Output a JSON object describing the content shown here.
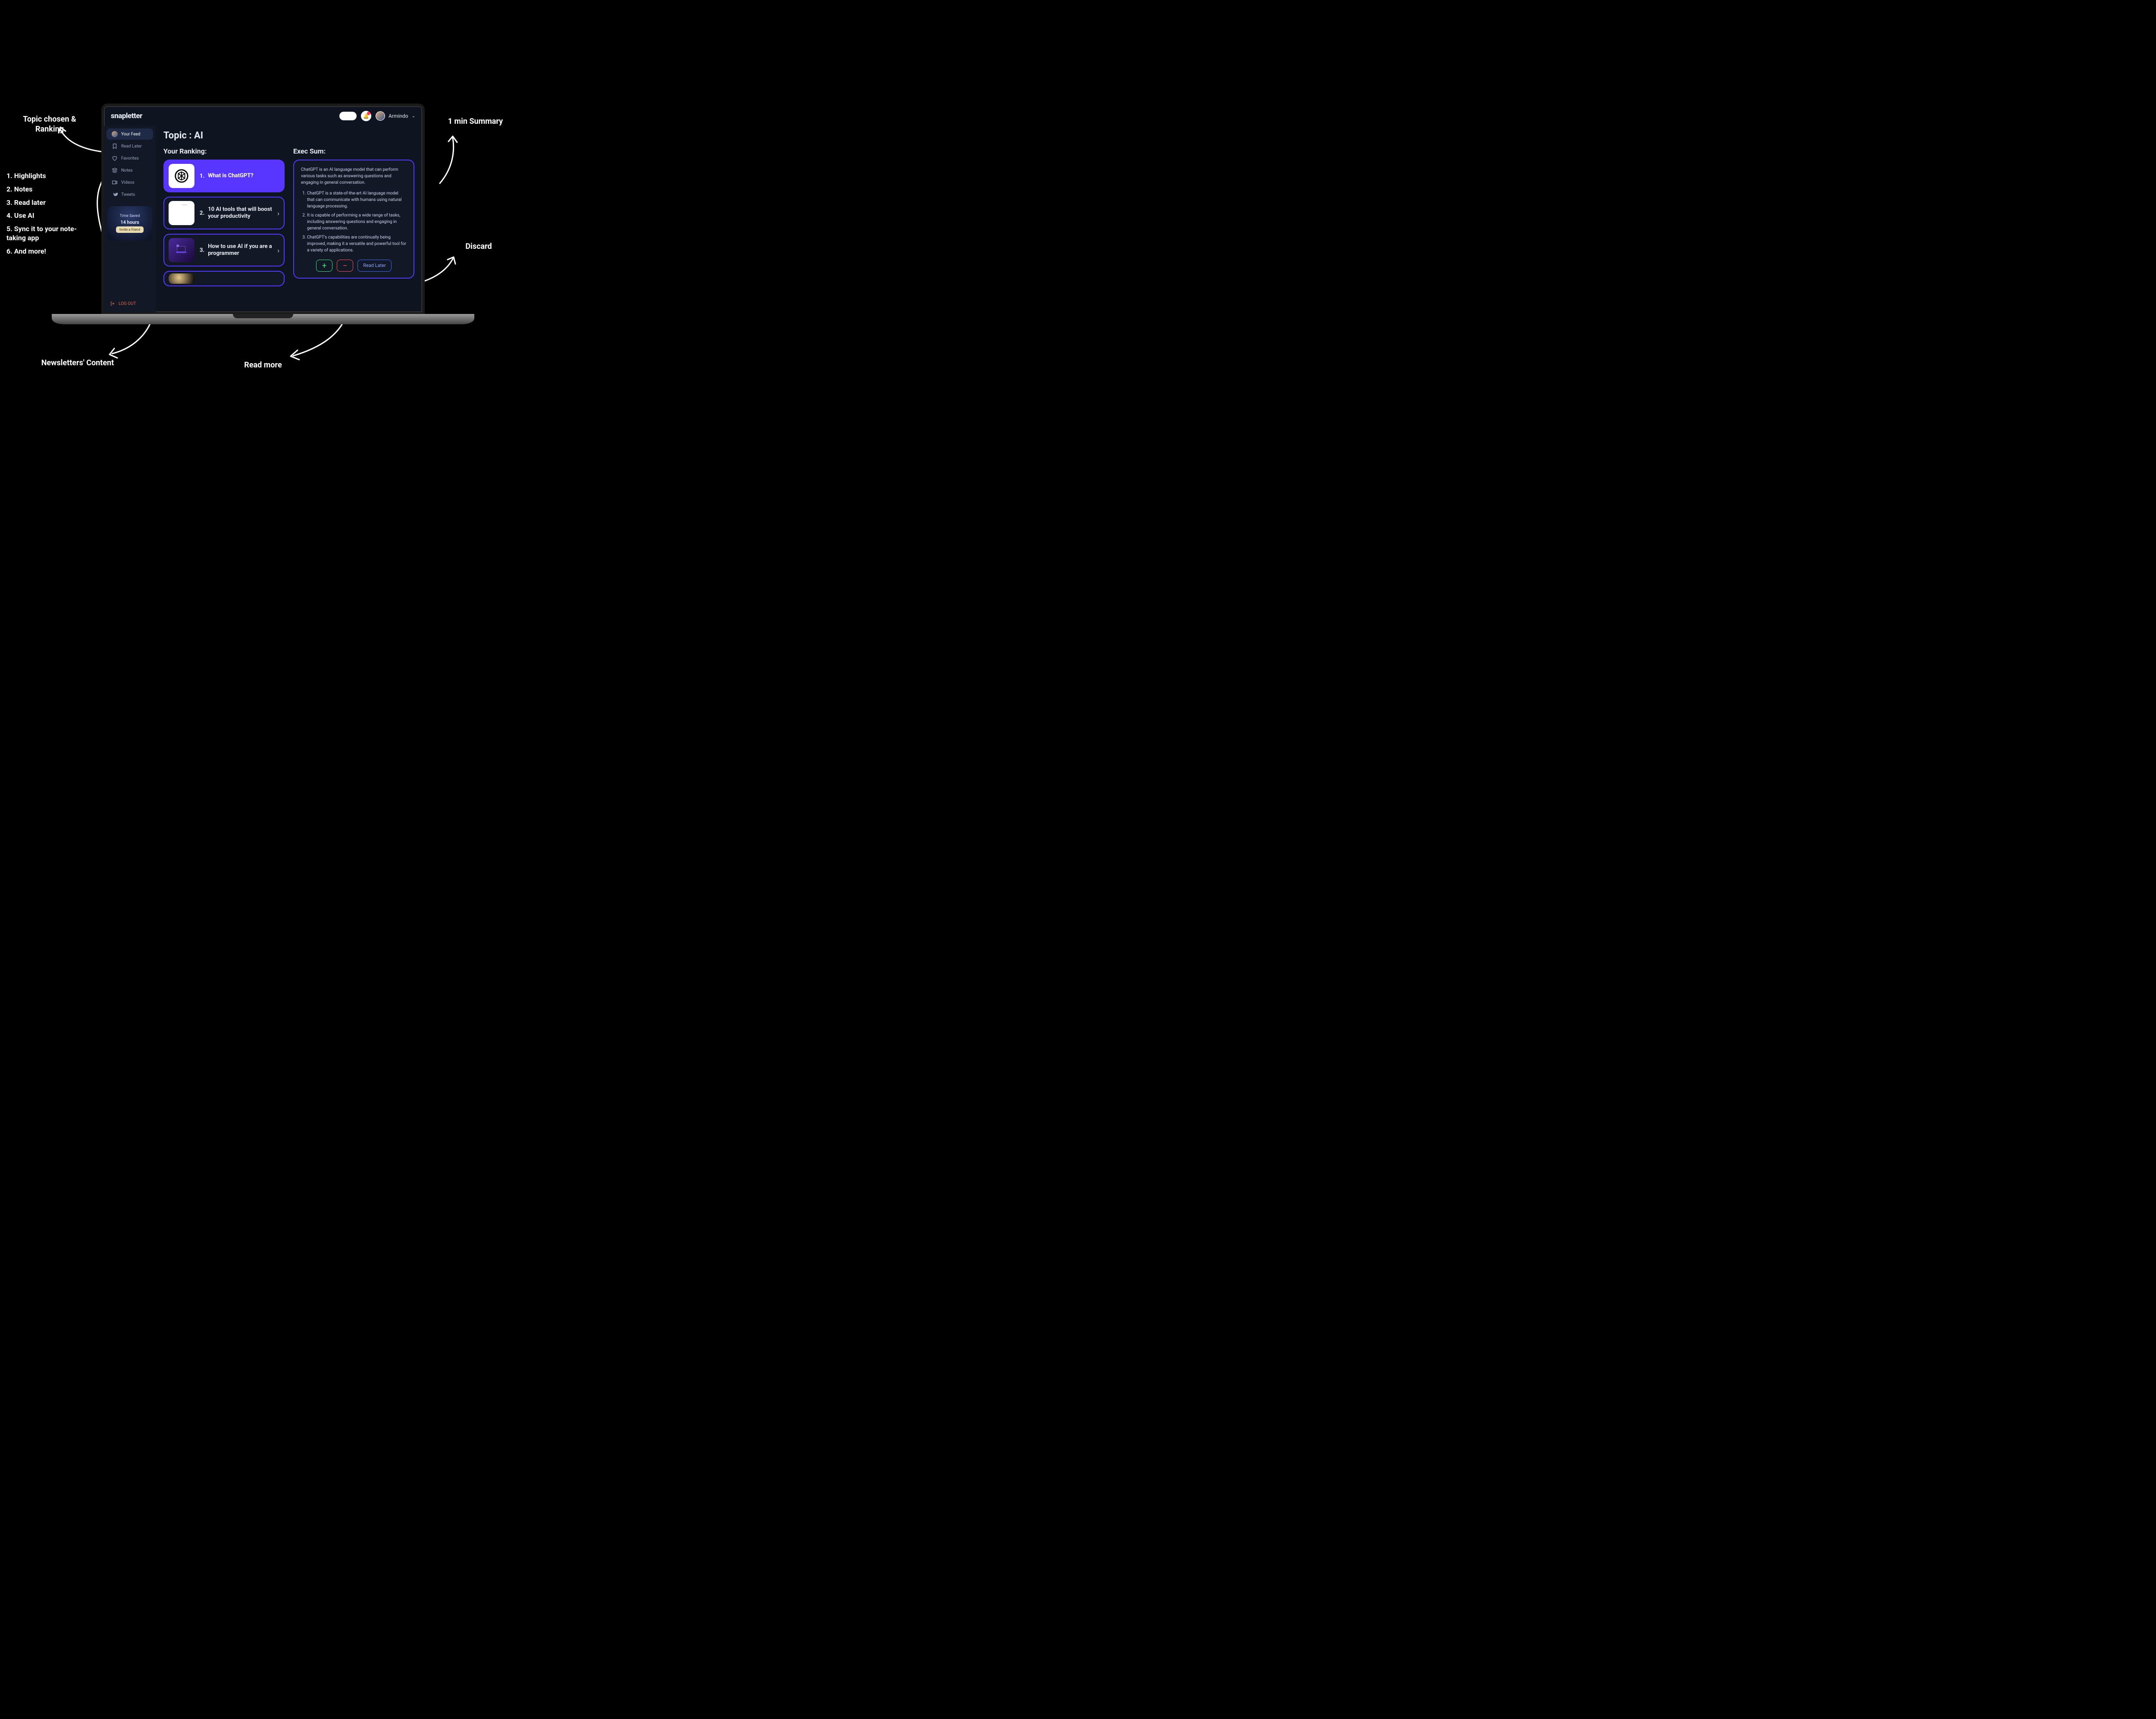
{
  "annotations": {
    "topic": "Topic chosen & Ranking",
    "list": [
      "1. Highlights",
      "2. Notes",
      "3. Read later",
      "4. Use AI",
      "5. Sync it to your note-taking app",
      "6. And more!"
    ],
    "newsletters": "Newsletters' Content",
    "readmore": "Read more",
    "summary": "1 min Summary",
    "discard": "Discard"
  },
  "header": {
    "logo": "snapletter",
    "user_name": "Armindo"
  },
  "sidebar": {
    "items": [
      {
        "label": "Your Feed",
        "icon": "avatar"
      },
      {
        "label": "Read Later",
        "icon": "bookmark"
      },
      {
        "label": "Favorites",
        "icon": "heart"
      },
      {
        "label": "Notes",
        "icon": "stack"
      },
      {
        "label": "Videos",
        "icon": "video"
      },
      {
        "label": "Tweets",
        "icon": "twitter"
      }
    ],
    "promo": {
      "title": "Time Saved",
      "hours": "14 hours",
      "cta": "Invite a friend"
    },
    "logout": "LOG OUT"
  },
  "topic": {
    "label": "Topic : AI"
  },
  "ranking": {
    "title": "Your Ranking:",
    "items": [
      {
        "num": "1.",
        "title": "What is ChatGPT?"
      },
      {
        "num": "2.",
        "title": "10 AI tools that will boost your productivity"
      },
      {
        "num": "3.",
        "title": "How to use AI if you are a programmer"
      }
    ]
  },
  "exec": {
    "title": "Exec Sum:",
    "intro": "ChatGPT is an AI language model that can perform various tasks such as answering questions and engaging in general conversation.",
    "bullets": [
      "ChatGPT is a state-of-the-art AI language model that can communicate with humans using natural language processing.",
      "It is capable of performing a wide range of tasks, including answering questions and engaging in general conversation.",
      "ChatGPT's capabilities are continually being improved, making it a versatile and powerful tool for a variety of applications."
    ],
    "actions": {
      "add": "+",
      "minus": "−",
      "later": "Read Later"
    }
  }
}
